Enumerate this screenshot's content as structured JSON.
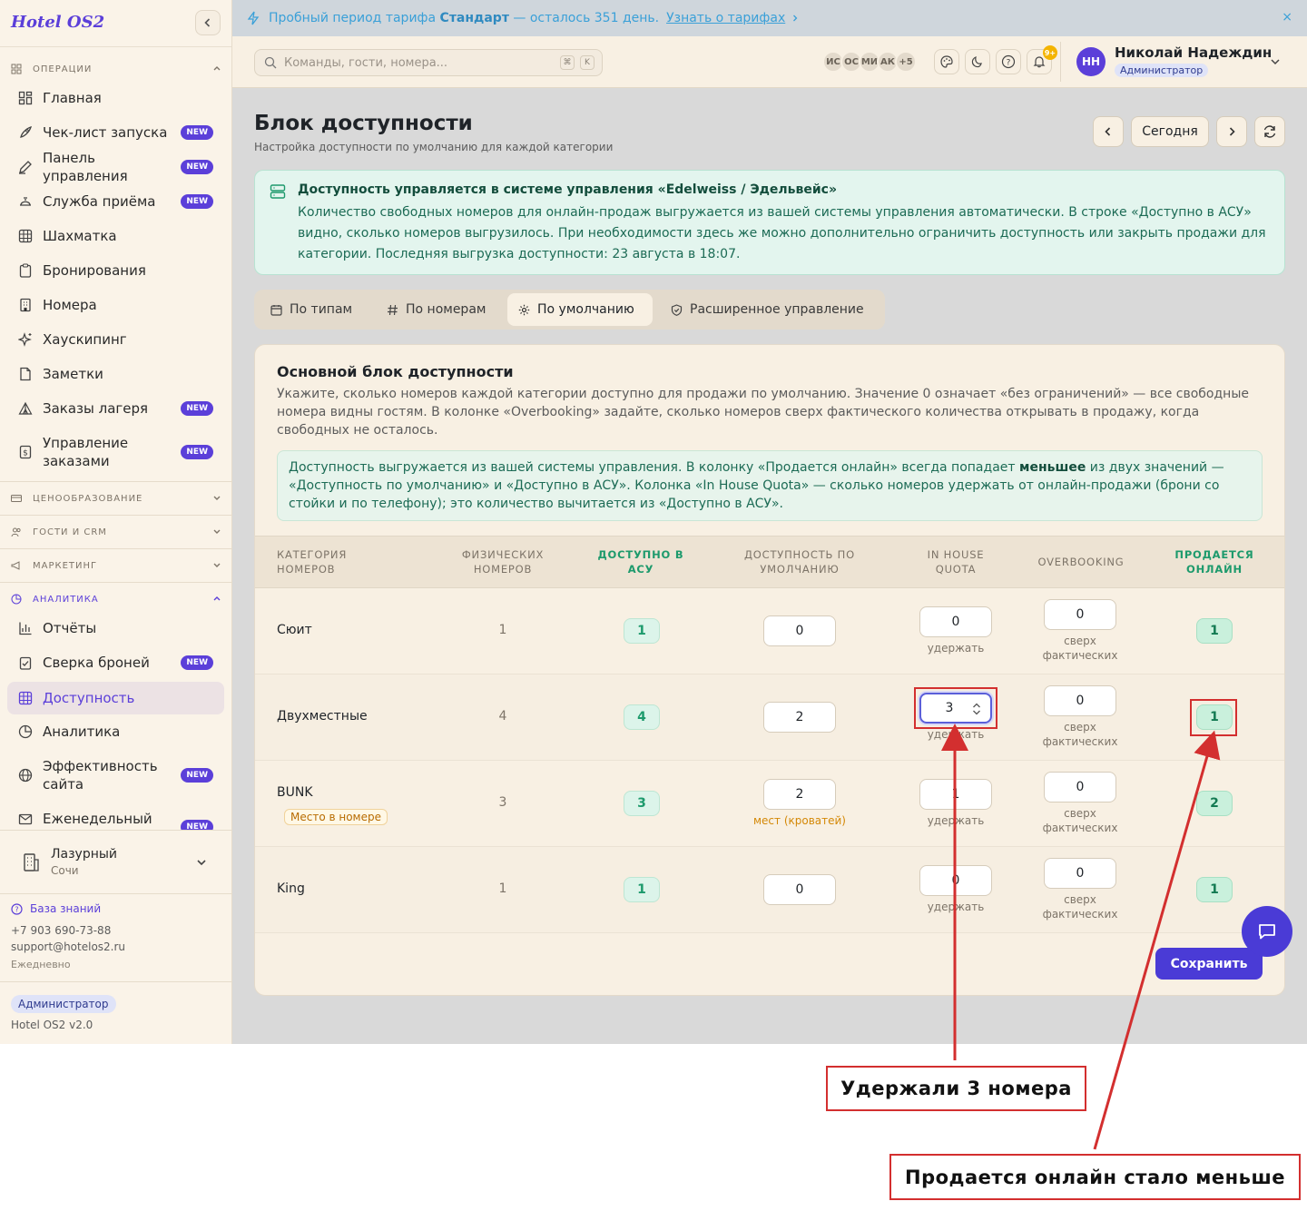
{
  "app": {
    "logo": "Hotel OS2"
  },
  "banner": {
    "prefix": "Пробный период тарифа",
    "plan": "Стандарт",
    "suffix": "— осталось 351 день.",
    "link": "Узнать о тарифах",
    "close": "×"
  },
  "search": {
    "placeholder": "Команды, гости, номера...",
    "kbd1": "⌘",
    "kbd2": "K"
  },
  "header": {
    "avatars": [
      "ИС",
      "ОС",
      "МИ",
      "АК",
      "+5"
    ],
    "notif_count": "9+",
    "user_initials": "НН",
    "user_name": "Николай Надеждин",
    "user_role": "Администратор"
  },
  "sidebar": {
    "sections": {
      "operations": "Операции",
      "pricing": "Ценообразование",
      "guests": "Гости и CRM",
      "marketing": "Маркетинг",
      "analytics": "Аналитика"
    },
    "items": [
      {
        "label": "Главная",
        "icon": "dashboard-icon",
        "badge": ""
      },
      {
        "label": "Чек-лист запуска",
        "icon": "rocket-icon",
        "badge": "NEW"
      },
      {
        "label": "Панель управления",
        "icon": "pencil-icon",
        "badge": "NEW"
      },
      {
        "label": "Служба приёма",
        "icon": "bell-service-icon",
        "badge": "NEW"
      },
      {
        "label": "Шахматка",
        "icon": "grid-icon",
        "badge": ""
      },
      {
        "label": "Бронирования",
        "icon": "clipboard-icon",
        "badge": ""
      },
      {
        "label": "Номера",
        "icon": "building-icon",
        "badge": ""
      },
      {
        "label": "Хаускипинг",
        "icon": "sparkle-icon",
        "badge": ""
      },
      {
        "label": "Заметки",
        "icon": "note-icon",
        "badge": ""
      },
      {
        "label": "Заказы лагеря",
        "icon": "tent-icon",
        "badge": "NEW"
      },
      {
        "label": "Управление заказами",
        "icon": "dollar-doc-icon",
        "badge": "NEW"
      },
      {
        "label": "Отчёты",
        "icon": "bar-chart-icon",
        "badge": ""
      },
      {
        "label": "Сверка броней",
        "icon": "check-doc-icon",
        "badge": "NEW"
      },
      {
        "label": "Доступность",
        "icon": "grid-icon",
        "badge": ""
      },
      {
        "label": "Аналитика",
        "icon": "pie-chart-icon",
        "badge": ""
      },
      {
        "label": "Эффективность сайта",
        "icon": "globe-icon",
        "badge": "NEW"
      },
      {
        "label": "Еженедельный",
        "icon": "mail-icon",
        "badge": "NEW"
      }
    ],
    "hotel": {
      "name": "Лазурный",
      "city": "Сочи"
    },
    "kb_link": "База знаний",
    "phone": "+7 903 690-73-88",
    "email": "support@hotelos2.ru",
    "schedule": "Ежедневно",
    "role": "Администратор",
    "version": "Hotel OS2 v2.0"
  },
  "page": {
    "title": "Блок доступности",
    "subtitle": "Настройка доступности по умолчанию для каждой категории",
    "today": "Сегодня"
  },
  "info": {
    "title": "Доступность управляется в системе управления «Edelweiss / Эдельвейс»",
    "text": "Количество свободных номеров для онлайн-продаж выгружается из вашей системы управления автоматически. В строке «Доступно в АСУ» видно, сколько номеров выгрузилось. При необходимости здесь же можно дополнительно ограничить доступность или закрыть продажи для категории. Последняя выгрузка доступности: 23 августа в 18:07."
  },
  "tabs": [
    "По типам",
    "По номерам",
    "По умолчанию",
    "Расширенное управление"
  ],
  "card": {
    "title": "Основной блок доступности",
    "desc": "Укажите, сколько номеров каждой категории доступно для продажи по умолчанию. Значение 0 означает «без ограничений» — все свободные номера видны гостям. В колонке «Overbooking» задайте, сколько номеров сверх фактического количества открывать в продажу, когда свободных не осталось.",
    "note_a": "Доступность выгружается из вашей системы управления. В колонку «Продается онлайн» всегда попадает ",
    "note_b": "меньшее",
    "note_c": " из двух значений — «Доступность по умолчанию» и «Доступно в АСУ». Колонка «In House Quota» — сколько номеров удержать от онлайн-продажи (брони со стойки и по телефону); это количество вычитается из «Доступно в АСУ».",
    "save": "Сохранить"
  },
  "table": {
    "headers": {
      "category": "Категория номеров",
      "physical": "Физических номеров",
      "asu": "Доступно в АСУ",
      "default": "Доступность по умолчанию",
      "quota": "In House Quota",
      "overbooking": "Overbooking",
      "online": "Продается онлайн"
    },
    "hold_label": "удержать",
    "over_label": "сверх фактических",
    "beds_label": "мест (кроватей)",
    "rows": [
      {
        "name": "Сюит",
        "tag": "",
        "physical": "1",
        "asu": "1",
        "default": "0",
        "quota": "0",
        "overbooking": "0",
        "online": "1"
      },
      {
        "name": "Двухместные",
        "tag": "",
        "physical": "4",
        "asu": "4",
        "default": "2",
        "quota": "3",
        "overbooking": "0",
        "online": "1"
      },
      {
        "name": "BUNK",
        "tag": "Место в номере",
        "physical": "3",
        "asu": "3",
        "default": "2",
        "quota": "1",
        "overbooking": "0",
        "online": "2"
      },
      {
        "name": "King",
        "tag": "",
        "physical": "1",
        "asu": "1",
        "default": "0",
        "quota": "0",
        "overbooking": "0",
        "online": "1"
      }
    ]
  },
  "annotations": {
    "held": "Удержали 3 номера",
    "online_less": "Продается онлайн стало меньше"
  }
}
